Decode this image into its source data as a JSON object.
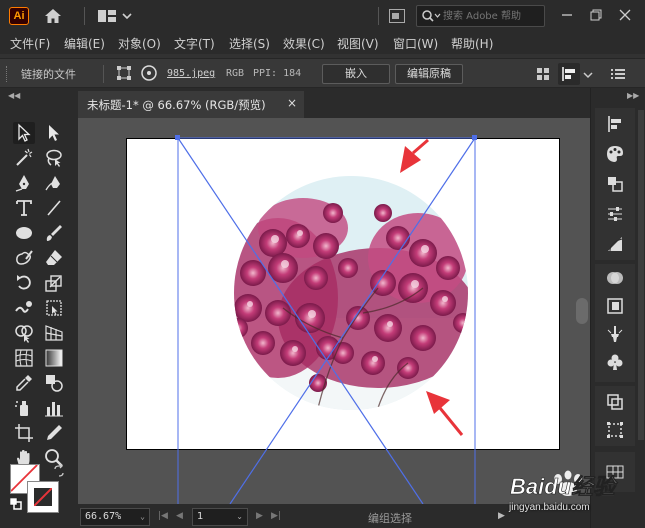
{
  "titlebar": {
    "app_logo": "Ai",
    "search_placeholder": "搜索 Adobe 帮助"
  },
  "menu": [
    "文件(F)",
    "编辑(E)",
    "对象(O)",
    "文字(T)",
    "选择(S)",
    "效果(C)",
    "视图(V)",
    "窗口(W)",
    "帮助(H)"
  ],
  "control_bar": {
    "linked_file_label": "链接的文件",
    "file_name": "985.jpeg",
    "color_mode": "RGB",
    "ppi": "PPI: 184",
    "embed_button": "嵌入",
    "edit_original_button": "编辑原稿"
  },
  "document": {
    "tab_title": "未标题-1* @ 66.67% (RGB/预览)",
    "close_glyph": "×"
  },
  "status": {
    "zoom": "66.67%",
    "page": "1",
    "tool_status": "编组选择"
  },
  "watermark": {
    "brand": "Baidu经验",
    "url": "jingyan.baidu.com"
  },
  "colors": {
    "accent_orange": "#ff9a00",
    "bounding_box_blue": "#4f6fe8",
    "arrow_red": "#e8343a",
    "ui_dark": "#2b2b2b",
    "canvas_gray": "#535353"
  }
}
